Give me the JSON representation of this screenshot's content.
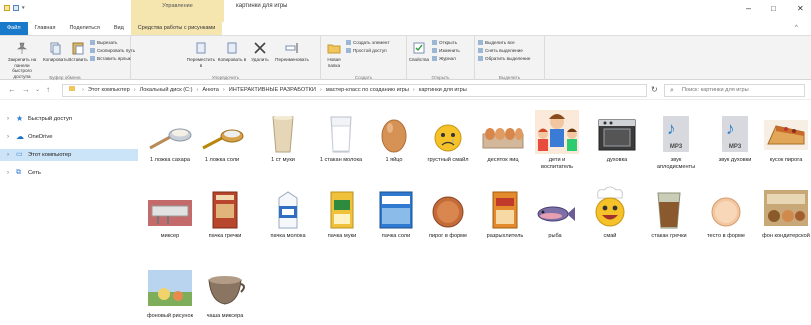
{
  "titlebar": {
    "context_tab_title": "Управление",
    "window_title": "картинки для игры",
    "minimize": "–",
    "maximize": "□",
    "close": "✕",
    "help": "^"
  },
  "tabs": {
    "file": "Файл",
    "home": "Главная",
    "share": "Поделиться",
    "view": "Вид",
    "context": "Средства работы с рисунками"
  },
  "ribbon": {
    "clipboard": {
      "pin": "Закрепить на панели быстрого доступа",
      "copy": "Копировать",
      "paste": "Вставить",
      "cut": "Вырезать",
      "copy_path": "Скопировать путь",
      "paste_shortcut": "Вставить ярлык",
      "label": "Буфер обмена"
    },
    "organize": {
      "move_to": "Переместить в",
      "copy_to": "Копировать в",
      "delete": "Удалить",
      "rename": "Переименовать",
      "label": "Упорядочить"
    },
    "create": {
      "new_folder": "Новая папка",
      "new_item": "Создать элемент",
      "easy_access": "Простой доступ",
      "label": "Создать"
    },
    "open": {
      "properties": "Свойства",
      "open": "Открыть",
      "edit": "Изменить",
      "history": "Журнал",
      "label": "Открыть"
    },
    "select": {
      "select_all": "Выделить все",
      "select_none": "Снять выделение",
      "invert": "Обратить выделение",
      "label": "Выделить"
    }
  },
  "address": {
    "crumbs": [
      "Этот компьютер",
      "Локальный диск (C:)",
      "Анюта",
      "ИНТЕРАКТИВНЫЕ РАЗРАБОТКИ",
      "мастер-класс по созданию игры",
      "картинки для игры"
    ],
    "search_placeholder": "Поиск: картинки для игры",
    "back": "←",
    "forward": "→",
    "up": "↑",
    "recent": "⌄",
    "refresh": "↻",
    "dropdown": "⌄"
  },
  "nav": [
    {
      "label": "Быстрый доступ",
      "icon": "★",
      "color": "#2d7fd3"
    },
    {
      "label": "OneDrive",
      "icon": "☁",
      "color": "#1b6fc6"
    },
    {
      "label": "Этот компьютер",
      "icon": "🖥",
      "color": "#3a7bd5"
    },
    {
      "label": "Сеть",
      "icon": "🖧",
      "color": "#3a7bd5"
    }
  ],
  "files": [
    {
      "label": "1 ложка сахара",
      "icon": "spoon-sugar-icon"
    },
    {
      "label": "1 ложка соли",
      "icon": "spoon-salt-icon"
    },
    {
      "label": "1 ст муки",
      "icon": "glass-flour-icon"
    },
    {
      "label": "1 стакан молока",
      "icon": "glass-milk-icon"
    },
    {
      "label": "1 яйцо",
      "icon": "egg-icon"
    },
    {
      "label": "грустный смайл",
      "icon": "sad-smiley-icon"
    },
    {
      "label": "десяток яиц",
      "icon": "egg-carton-icon"
    },
    {
      "label": "дети и воспитатель",
      "icon": "children-teacher-icon"
    },
    {
      "label": "духовка",
      "icon": "oven-icon"
    },
    {
      "label": "звук аплодисменты",
      "icon": "mp3-icon"
    },
    {
      "label": "звук духовки",
      "icon": "mp3-icon"
    },
    {
      "label": "кусок пирога",
      "icon": "pie-slice-icon"
    },
    {
      "label": "миксер",
      "icon": "mixer-icon"
    },
    {
      "label": "пачка гречки",
      "icon": "buckwheat-pack-icon"
    },
    {
      "label": "пачка молока",
      "icon": "milk-pack-icon"
    },
    {
      "label": "пачка муки",
      "icon": "flour-pack-icon"
    },
    {
      "label": "пачка соли",
      "icon": "salt-pack-icon"
    },
    {
      "label": "пирог в форме",
      "icon": "pie-in-form-icon"
    },
    {
      "label": "разрыхлитель",
      "icon": "baking-powder-icon"
    },
    {
      "label": "рыба",
      "icon": "fish-icon"
    },
    {
      "label": "смай",
      "icon": "chef-smiley-icon"
    },
    {
      "label": "стакан гречки",
      "icon": "glass-buckwheat-icon"
    },
    {
      "label": "тесто в форме",
      "icon": "dough-in-form-icon"
    },
    {
      "label": "фон кондитерской",
      "icon": "bakery-background-icon"
    },
    {
      "label": "фоновый рисунок",
      "icon": "background-picture-icon"
    },
    {
      "label": "чаша миксера",
      "icon": "mixer-bowl-icon"
    }
  ]
}
